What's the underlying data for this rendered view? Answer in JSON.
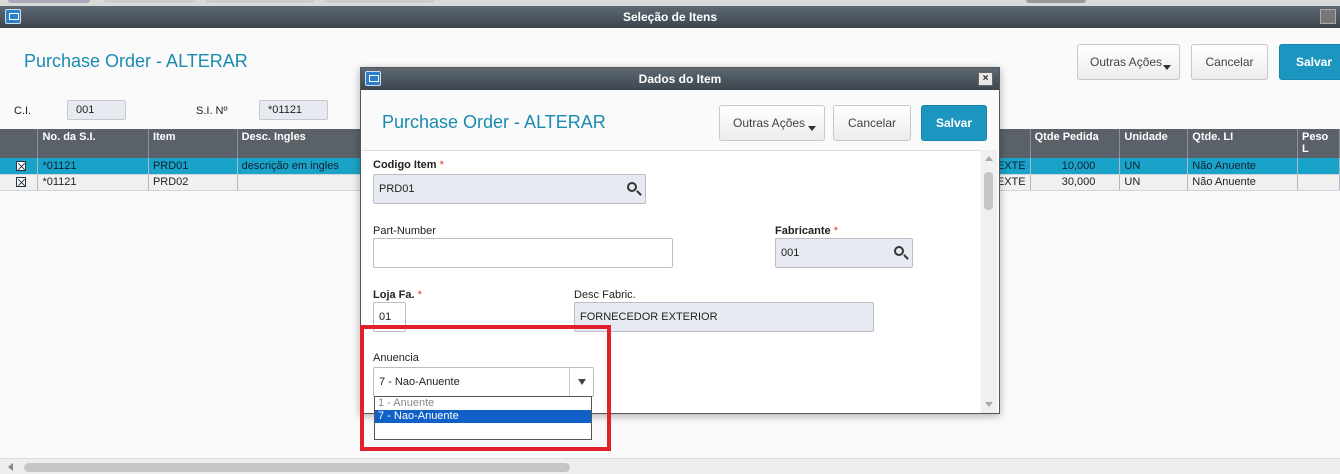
{
  "outer": {
    "title": "Seleção de Itens",
    "page_title": "Purchase Order - ALTERAR",
    "buttons": {
      "other_actions": "Outras Ações",
      "cancel": "Cancelar",
      "save": "Salvar"
    },
    "ci_label": "C.I.",
    "ci_value": "001",
    "si_label": "S.I. Nº",
    "si_value": "*01121"
  },
  "grid": {
    "columns": [
      "",
      "No. da S.I.",
      "Item",
      "Desc. Ingles",
      "",
      "Qtde Pedida",
      "Unidade",
      "Qtde. LI",
      "Peso L"
    ],
    "rows": [
      {
        "no_si": "*01121",
        "item": "PRD01",
        "desc": "descrição em ingles",
        "ext": "EXTE",
        "qtde": "10,000",
        "unidade": "UN",
        "qtde_li": "Não Anuente",
        "selected": true
      },
      {
        "no_si": "*01121",
        "item": "PRD02",
        "desc": "",
        "ext": "EXTE",
        "qtde": "30,000",
        "unidade": "UN",
        "qtde_li": "Não Anuente",
        "selected": false
      }
    ]
  },
  "dialog": {
    "title": "Dados do Item",
    "close_label": "×",
    "page_title": "Purchase Order - ALTERAR",
    "buttons": {
      "other_actions": "Outras Ações",
      "cancel": "Cancelar",
      "save": "Salvar"
    },
    "fields": {
      "codigo_item": {
        "label": "Codigo Item",
        "required": "*",
        "value": "PRD01"
      },
      "part_number": {
        "label": "Part-Number",
        "value": ""
      },
      "fabricante": {
        "label": "Fabricante",
        "required": "*",
        "value": "001"
      },
      "loja_fa": {
        "label": "Loja Fa.",
        "required": "*",
        "value": "01"
      },
      "desc_fabric": {
        "label": "Desc Fabric.",
        "value": "FORNECEDOR EXTERIOR"
      },
      "anuencia": {
        "label": "Anuencia",
        "value": "7 - Nao-Anuente",
        "options": [
          "1 - Anuente",
          "7 - Nao-Anuente"
        ]
      }
    }
  },
  "colors": {
    "accent": "#1c96c1",
    "title_bar": "#4a545c",
    "highlight": "#e0202a",
    "grid_selected": "#1aa3c8"
  }
}
